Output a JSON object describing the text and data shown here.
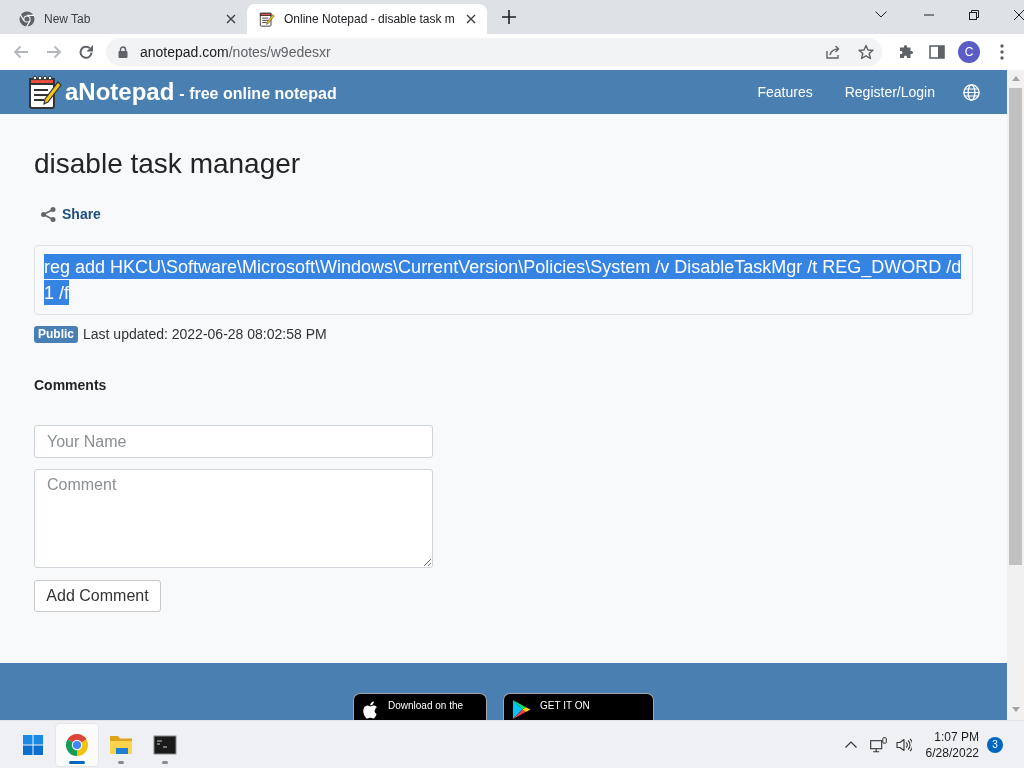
{
  "browser": {
    "tabs": [
      {
        "kind": "newtab",
        "title": "New Tab",
        "selected": false
      },
      {
        "kind": "notepad",
        "title": "Online Notepad - disable task m",
        "selected": true
      }
    ],
    "url": {
      "host": "anotepad.com",
      "path": "/notes/w9edesxr"
    },
    "profile_initial": "C"
  },
  "site_header": {
    "brand": "aNotepad",
    "tagline": "- free online notepad",
    "nav": [
      "Features",
      "Register/Login"
    ]
  },
  "note": {
    "title": "disable task manager",
    "share": "Share",
    "content": "reg add HKCU\\Software\\Microsoft\\Windows\\CurrentVersion\\Policies\\System /v DisableTaskMgr /t REG_DWORD /d 1 /f",
    "content_selected": true,
    "visibility": "Public",
    "last_updated": "Last updated: 2022-06-28 08:02:58 PM"
  },
  "comments": {
    "heading": "Comments",
    "name_placeholder": "Your Name",
    "comment_placeholder": "Comment",
    "submit": "Add Comment"
  },
  "footer": {
    "store_badges": [
      {
        "kind": "apple",
        "caption": "Download on the"
      },
      {
        "kind": "google",
        "caption": "GET IT ON"
      }
    ]
  },
  "taskbar": {
    "apps": [
      {
        "kind": "browser",
        "selected": true
      },
      {
        "kind": "files",
        "selected": false
      },
      {
        "kind": "terminal",
        "selected": false
      }
    ],
    "time": "1:07 PM",
    "date": "6/28/2022",
    "notifications": "3"
  }
}
